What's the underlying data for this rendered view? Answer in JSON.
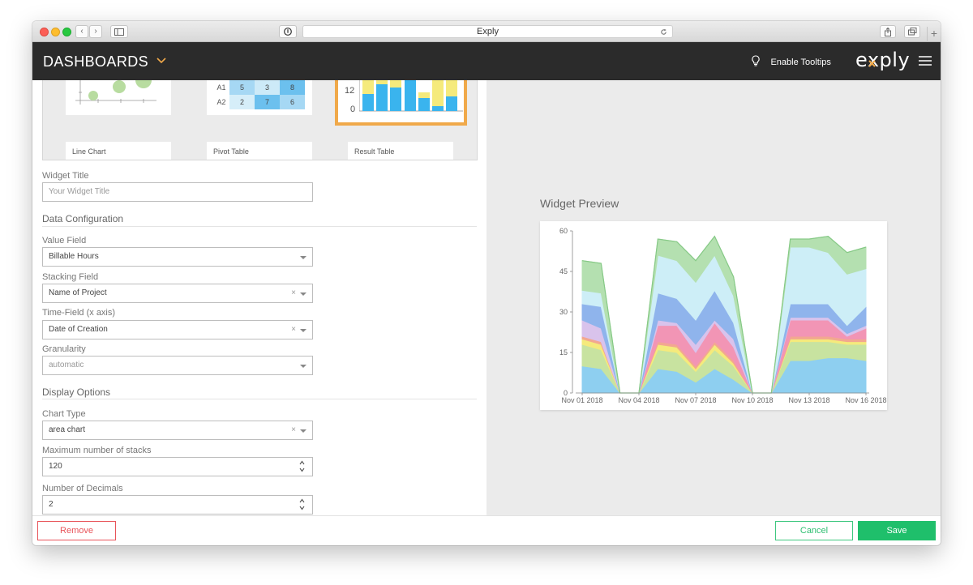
{
  "browser": {
    "url_title": "Exply",
    "back_glyph": "‹",
    "forward_glyph": "›",
    "new_tab_glyph": "+"
  },
  "header": {
    "title": "DASHBOARDS",
    "tooltips_label": "Enable Tooltips",
    "logo": "exply"
  },
  "gallery": {
    "items": [
      "Line Chart",
      "Pivot Table",
      "Result Table"
    ],
    "pivot": {
      "rows": [
        "A1",
        "A2"
      ],
      "cells": [
        [
          "5",
          "3",
          "8"
        ],
        [
          "2",
          "7",
          "6"
        ]
      ]
    },
    "result_axis": [
      "12",
      "0"
    ]
  },
  "form": {
    "widget_title_label": "Widget Title",
    "widget_title_placeholder": "Your Widget Title",
    "data_config_heading": "Data Configuration",
    "value_field_label": "Value Field",
    "value_field_value": "Billable Hours",
    "stacking_field_label": "Stacking Field",
    "stacking_field_value": "Name of Project",
    "time_field_label": "Time-Field (x axis)",
    "time_field_value": "Date of Creation",
    "granularity_label": "Granularity",
    "granularity_value": "automatic",
    "display_options_heading": "Display Options",
    "chart_type_label": "Chart Type",
    "chart_type_value": "area chart",
    "max_stacks_label": "Maximum number of stacks",
    "max_stacks_value": "120",
    "decimals_label": "Number of Decimals",
    "decimals_value": "2",
    "clear_glyph": "×"
  },
  "preview": {
    "title": "Widget Preview"
  },
  "footer": {
    "remove_label": "Remove",
    "cancel_label": "Cancel",
    "save_label": "Save"
  },
  "colors": {
    "accent_orange": "#f0a94a",
    "save_green": "#1fbf6b",
    "remove_red": "#e8545a"
  },
  "chart_data": {
    "type": "area",
    "stacked": true,
    "x": [
      "Nov 01 2018",
      "Nov 02 2018",
      "Nov 03 2018",
      "Nov 04 2018",
      "Nov 05 2018",
      "Nov 06 2018",
      "Nov 07 2018",
      "Nov 08 2018",
      "Nov 09 2018",
      "Nov 10 2018",
      "Nov 11 2018",
      "Nov 12 2018",
      "Nov 13 2018",
      "Nov 14 2018",
      "Nov 15 2018",
      "Nov 16 2018"
    ],
    "x_tick_labels": [
      "Nov 01 2018",
      "Nov 04 2018",
      "Nov 07 2018",
      "Nov 10 2018",
      "Nov 13 2018",
      "Nov 16 2018"
    ],
    "y_ticks": [
      0,
      15,
      30,
      45,
      60
    ],
    "ylim": [
      0,
      60
    ],
    "grid": false,
    "series": [
      {
        "color": "#8ecff0",
        "values": [
          10,
          9,
          0,
          0,
          9,
          8,
          4,
          9,
          5,
          0,
          0,
          12,
          12,
          13,
          13,
          12
        ]
      },
      {
        "color": "#c8e3a0",
        "values": [
          8,
          7,
          0,
          0,
          7,
          7,
          4,
          7,
          5,
          0,
          0,
          7,
          7,
          6,
          5,
          6
        ]
      },
      {
        "color": "#f5ea7c",
        "values": [
          2,
          2,
          0,
          0,
          2,
          2,
          1,
          2,
          1,
          0,
          0,
          1,
          1,
          1,
          1,
          1
        ]
      },
      {
        "color": "#f2a890",
        "values": [
          1,
          1,
          0,
          0,
          1,
          1,
          1,
          1,
          1,
          0,
          0,
          1,
          1,
          1,
          1,
          1
        ]
      },
      {
        "color": "#f295b5",
        "values": [
          0,
          0,
          0,
          0,
          6,
          7,
          5,
          7,
          5,
          0,
          0,
          6,
          6,
          6,
          1,
          4
        ]
      },
      {
        "color": "#d9c3ec",
        "values": [
          6,
          5,
          0,
          0,
          2,
          1,
          3,
          1,
          3,
          0,
          0,
          1,
          1,
          1,
          1,
          1
        ]
      },
      {
        "color": "#8fb4ec",
        "values": [
          6,
          8,
          0,
          0,
          10,
          9,
          9,
          11,
          6,
          0,
          0,
          5,
          5,
          5,
          3,
          7
        ]
      },
      {
        "color": "#cdeef7",
        "values": [
          5,
          5,
          0,
          0,
          14,
          14,
          14,
          13,
          10,
          0,
          0,
          21,
          21,
          19,
          19,
          14
        ]
      },
      {
        "color": "#b4e0b0",
        "values": [
          11,
          11,
          0,
          0,
          6,
          7,
          8,
          7,
          7,
          0,
          0,
          3,
          3,
          6,
          8,
          8
        ]
      }
    ]
  }
}
